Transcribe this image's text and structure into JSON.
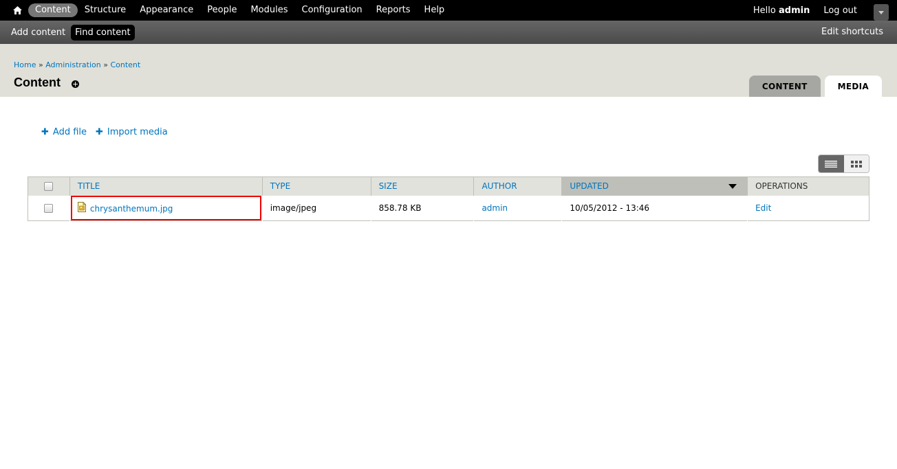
{
  "toolbar": {
    "menu": [
      "Content",
      "Structure",
      "Appearance",
      "People",
      "Modules",
      "Configuration",
      "Reports",
      "Help"
    ],
    "active": "Content",
    "hello_prefix": "Hello ",
    "username": "admin",
    "logout": "Log out"
  },
  "shortcuts": {
    "items": [
      "Add content",
      "Find content"
    ],
    "active": "Find content",
    "edit": "Edit shortcuts"
  },
  "breadcrumb": {
    "home": "Home",
    "sep": " » ",
    "administration": "Administration",
    "content": "Content"
  },
  "page": {
    "title": "Content"
  },
  "tabs": {
    "content": "CONTENT",
    "media": "MEDIA",
    "active": "MEDIA"
  },
  "actions": {
    "add_file": "Add file",
    "import_media": "Import media"
  },
  "table": {
    "headers": {
      "title": "TITLE",
      "type": "TYPE",
      "size": "SIZE",
      "author": "AUTHOR",
      "updated": "UPDATED",
      "operations": "OPERATIONS"
    },
    "sorted_column": "UPDATED",
    "rows": [
      {
        "title": "chrysanthemum.jpg",
        "type": "image/jpeg",
        "size": "858.78 KB",
        "author": "admin",
        "updated": "10/05/2012 - 13:46",
        "operation": "Edit"
      }
    ]
  },
  "colors": {
    "link": "#0074bd",
    "toolbar_bg": "#000000",
    "shortcut_bg": "#555555",
    "header_bg": "#e0e0d8",
    "highlight": "#ee0000"
  }
}
